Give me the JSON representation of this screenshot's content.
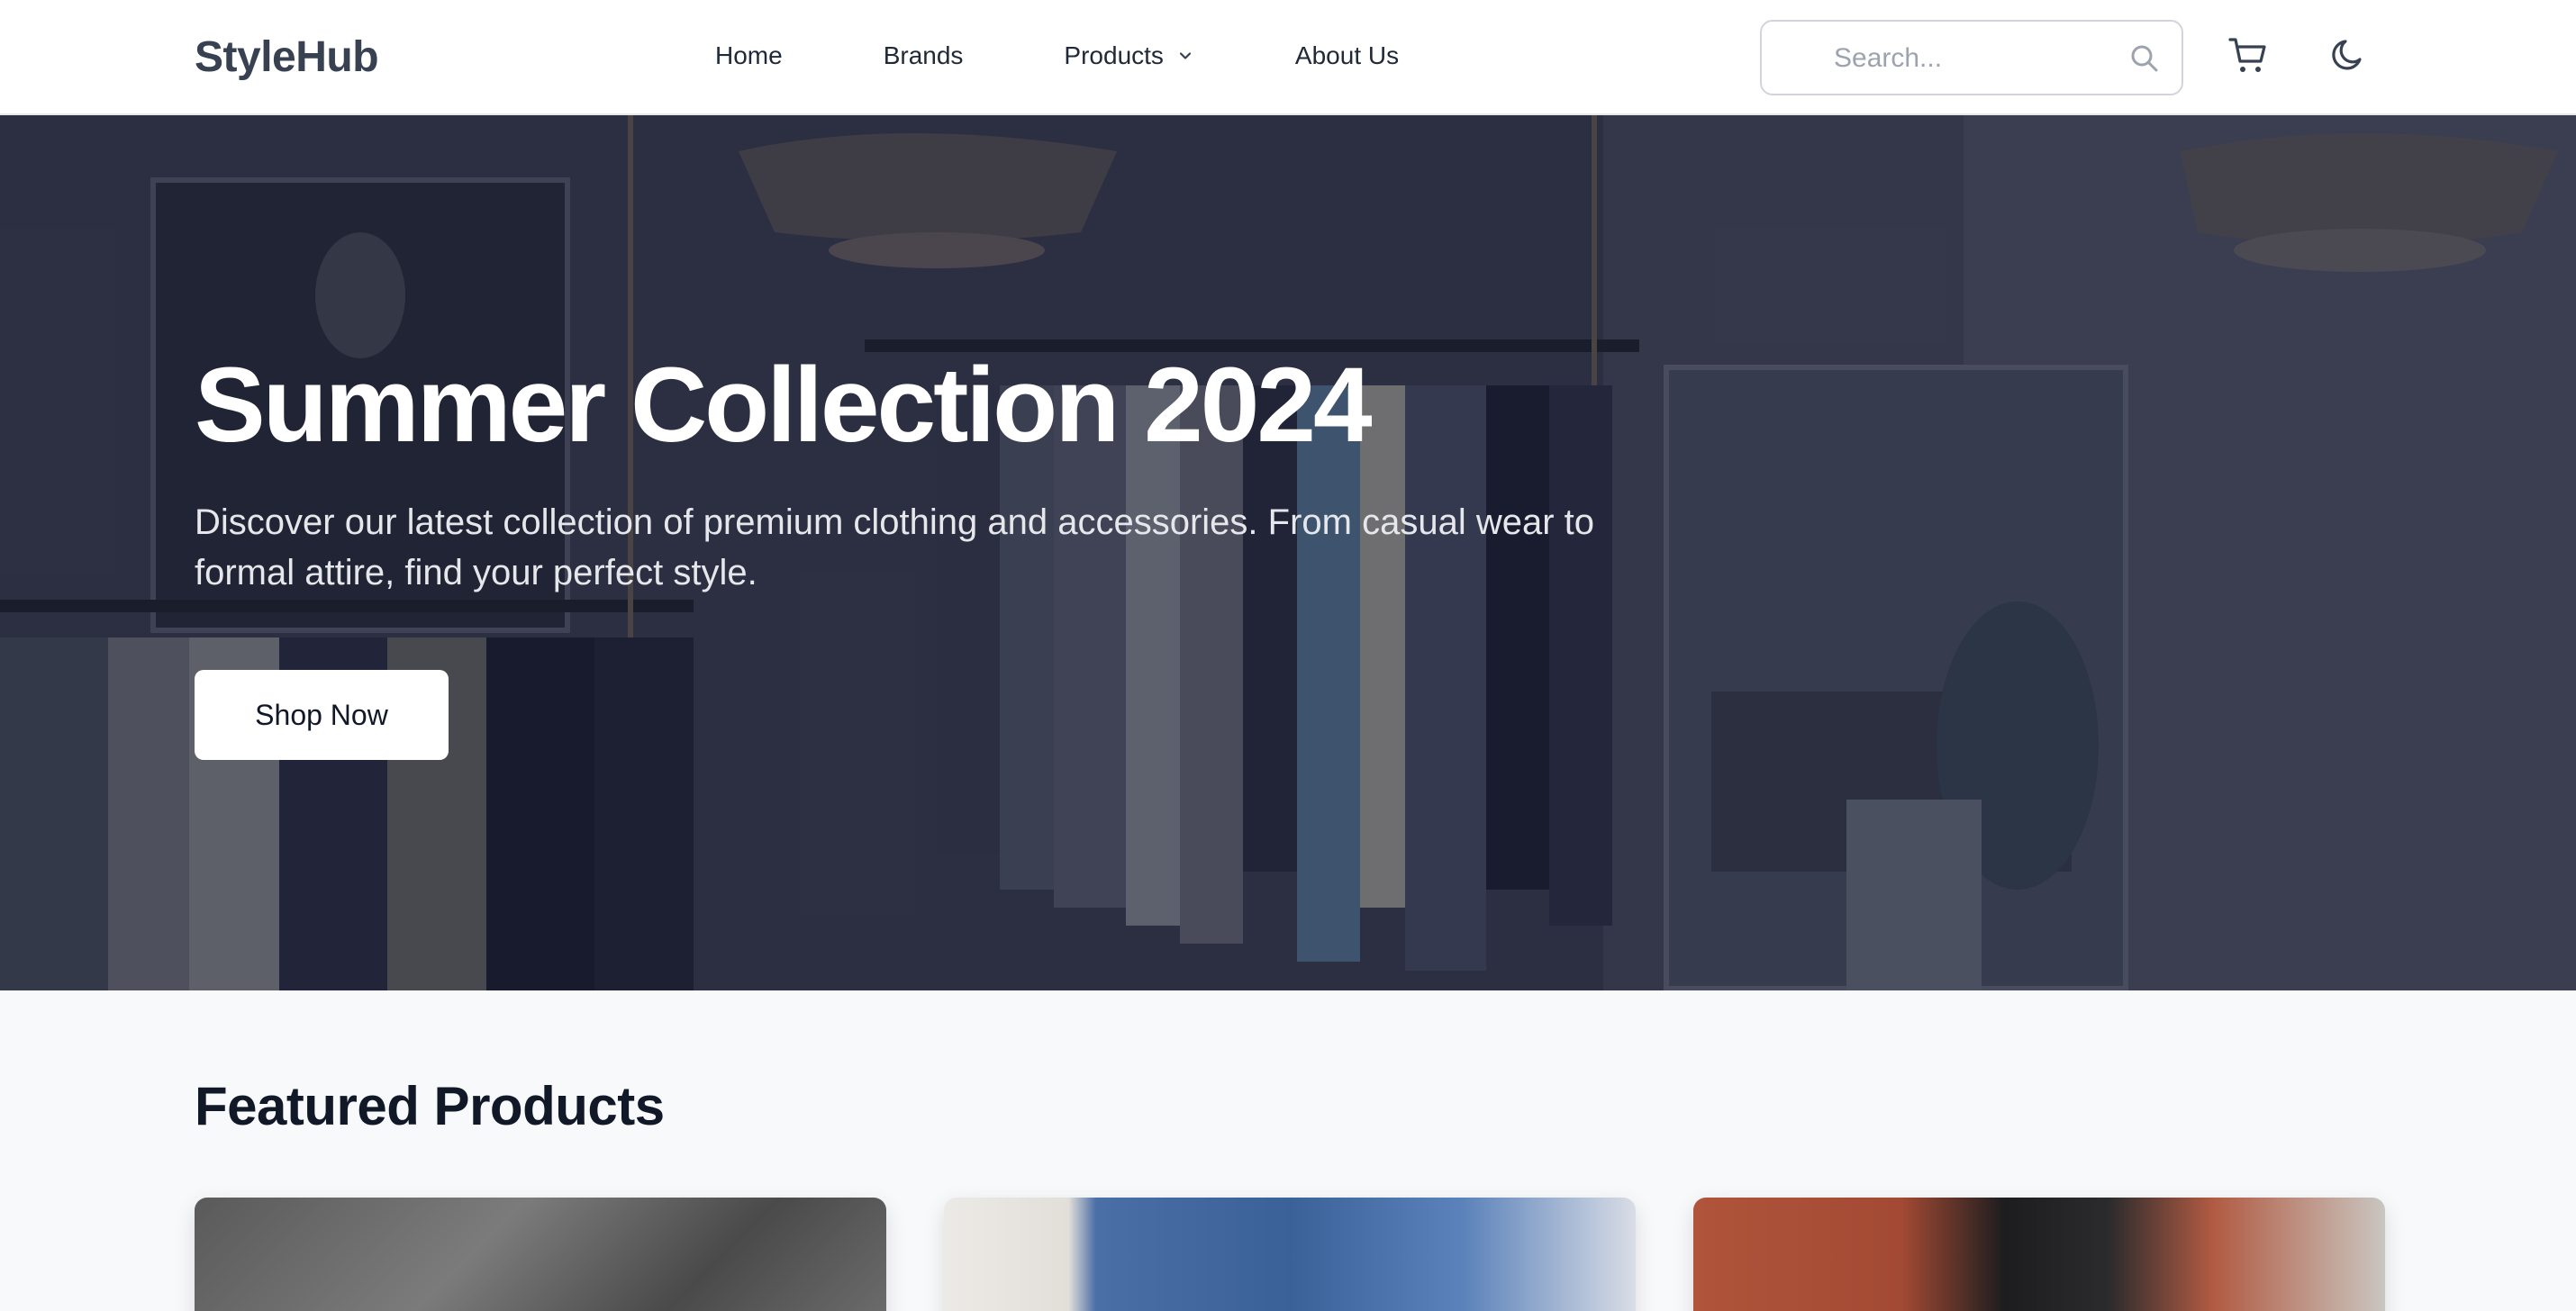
{
  "brand": {
    "name": "StyleHub"
  },
  "nav": {
    "items": [
      {
        "label": "Home"
      },
      {
        "label": "Brands"
      },
      {
        "label": "Products",
        "has_dropdown": true
      },
      {
        "label": "About Us"
      }
    ]
  },
  "search": {
    "placeholder": "Search...",
    "value": ""
  },
  "icons": {
    "search": "search-icon",
    "cart": "cart-icon",
    "theme": "moon-icon",
    "dropdown": "chevron-down-icon"
  },
  "hero": {
    "title": "Summer Collection 2024",
    "description": "Discover our latest collection of premium clothing and accessories. From casual wear to formal attire, find your perfect style.",
    "cta_label": "Shop Now"
  },
  "featured": {
    "title": "Featured Products",
    "products": [
      {
        "image": "gray-textured-image"
      },
      {
        "image": "denim-jacket-image"
      },
      {
        "image": "man-leather-jacket-image"
      }
    ]
  },
  "colors": {
    "header_bg": "#ffffff",
    "page_bg": "#f8f9fb",
    "text_dark": "#111827",
    "hero_text": "#ffffff"
  }
}
